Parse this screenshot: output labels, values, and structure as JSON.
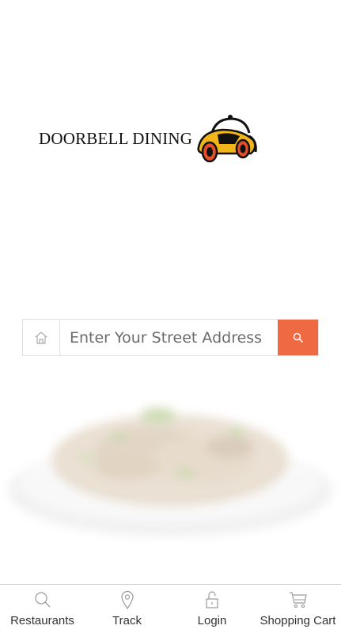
{
  "brand": {
    "name": "DOORBELL DINING",
    "colors": {
      "accent": "#ef6a43",
      "logo_yellow": "#f2b51a",
      "logo_red": "#e4502a",
      "text": "#111111"
    }
  },
  "search": {
    "placeholder": "Enter Your Street Address",
    "value": "",
    "home_icon": "home-icon",
    "submit_icon": "search-icon"
  },
  "bottom_nav": {
    "items": [
      {
        "label": "Restaurants",
        "icon": "search-icon"
      },
      {
        "label": "Track",
        "icon": "map-pin-icon"
      },
      {
        "label": "Login",
        "icon": "lock-icon"
      },
      {
        "label": "Shopping Cart",
        "icon": "cart-icon"
      }
    ]
  }
}
